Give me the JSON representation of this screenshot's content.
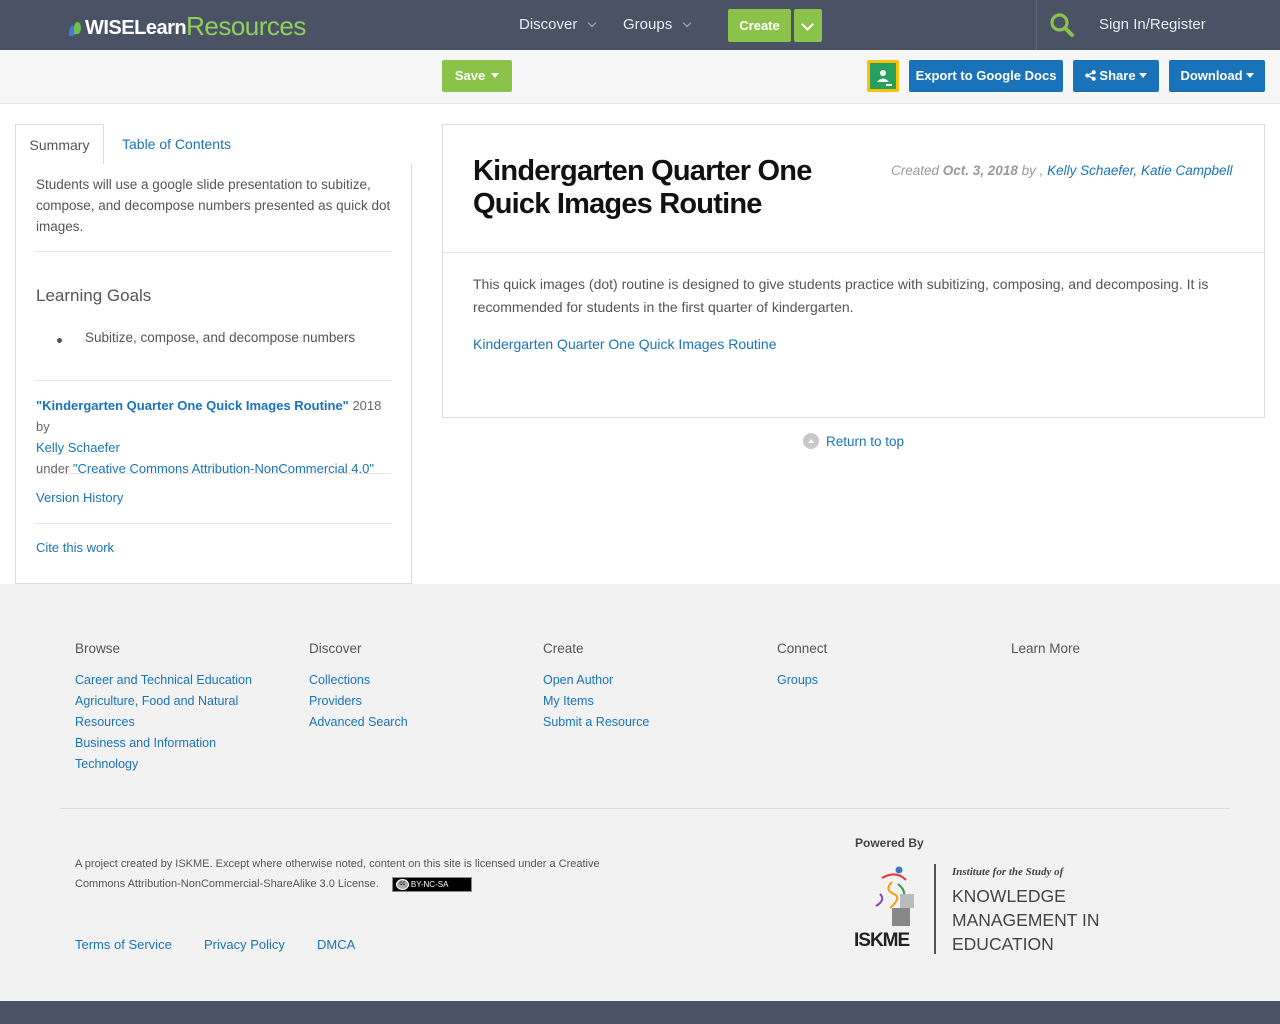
{
  "app": {
    "logo_wise": "WISELearn",
    "logo_resources": "Resources"
  },
  "topnav": {
    "discover": "Discover",
    "groups": "Groups",
    "create": "Create",
    "sign_in": "Sign In/Register"
  },
  "toolbar": {
    "save": "Save",
    "export": "Export to Google Docs",
    "share": "Share",
    "download": "Download"
  },
  "sidebar": {
    "tabs": [
      "Summary",
      "Table of Contents"
    ],
    "summary": "Students will use a google slide presentation to subitize, compose, and decompose numbers presented as quick dot images.",
    "learning_goals_title": "Learning Goals",
    "learning_goals": [
      "Subitize, compose, and decompose numbers"
    ],
    "attribution": {
      "work_title": "\"Kindergarten Quarter One Quick Images Routine\"",
      "year_by": " 2018 by",
      "author": "Kelly Schaefer",
      "under": "under ",
      "license": "\"Creative Commons Attribution-NonCommercial 4.0\""
    },
    "version_history": "Version History",
    "cite": "Cite this work"
  },
  "main": {
    "title": "Kindergarten Quarter One Quick Images Routine",
    "created_label": "Created ",
    "created_date": "Oct. 3, 2018",
    "by": " by , ",
    "authors": [
      "Kelly Schaefer",
      "Katie Campbell"
    ],
    "author_sep": ", ",
    "description": "This quick images (dot) routine is designed to give students practice with subitizing, composing, and decomposing.  It is recommended for students in the first quarter of kindergarten.",
    "resource_link": "Kindergarten Quarter One Quick Images Routine",
    "return_to_top": "Return to top"
  },
  "footer": {
    "columns": [
      {
        "heading": "Browse",
        "links": [
          "Career and Technical Education",
          "Agriculture, Food and Natural Resources",
          "Business and Information Technology"
        ]
      },
      {
        "heading": "Discover",
        "links": [
          "Collections",
          "Providers",
          "Advanced Search"
        ]
      },
      {
        "heading": "Create",
        "links": [
          "Open Author",
          "My Items",
          "Submit a Resource"
        ]
      },
      {
        "heading": "Connect",
        "links": [
          "Groups"
        ]
      },
      {
        "heading": "Learn More",
        "links": []
      }
    ],
    "legal": "A project created by ISKME. Except where otherwise noted, content on this site is licensed under a Creative Commons Attribution-NonCommercial-ShareAlike 3.0 License.",
    "cc_badge": "BY-NC-SA",
    "links": [
      "Terms of Service",
      "Privacy Policy",
      "DMCA"
    ],
    "powered_by": "Powered By",
    "iskme_word": "ISKME",
    "iskme_institute": "Institute for the Study of",
    "iskme_name": [
      "KNOWLEDGE",
      "MANAGEMENT IN",
      "EDUCATION"
    ]
  },
  "colors": {
    "nav_bg": "#4a5366",
    "accent_green": "#8bc34a",
    "accent_blue": "#1a73b8",
    "link": "#1a73b8"
  }
}
